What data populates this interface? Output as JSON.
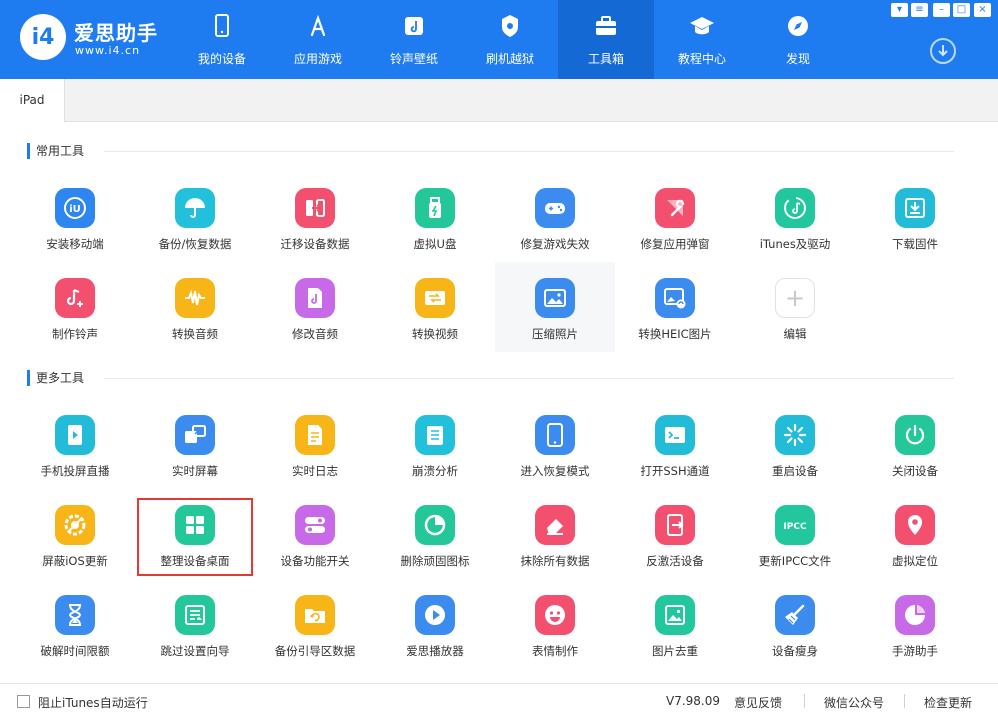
{
  "app": {
    "logo_badge": "i4",
    "name": "爱思助手",
    "url": "www.i4.cn"
  },
  "nav": [
    {
      "label": "我的设备",
      "icon": "phone-icon",
      "active": false
    },
    {
      "label": "应用游戏",
      "icon": "appstore-icon",
      "active": false
    },
    {
      "label": "铃声壁纸",
      "icon": "music-wallpaper-icon",
      "active": false
    },
    {
      "label": "刷机越狱",
      "icon": "flash-icon",
      "active": false
    },
    {
      "label": "工具箱",
      "icon": "toolbox-icon",
      "active": true
    },
    {
      "label": "教程中心",
      "icon": "graduation-cap-icon",
      "active": false
    },
    {
      "label": "发现",
      "icon": "compass-icon",
      "active": false
    }
  ],
  "window_controls": [
    "skin",
    "menu",
    "minimize",
    "close"
  ],
  "tabs": [
    "iPad"
  ],
  "sections": {
    "common": {
      "title": "常用工具"
    },
    "more": {
      "title": "更多工具"
    }
  },
  "common_tools": [
    {
      "label": "安装移动端",
      "icon": "i4-app-icon",
      "color": "#2E86F0"
    },
    {
      "label": "备份/恢复数据",
      "icon": "umbrella-icon",
      "color": "#22C0DA"
    },
    {
      "label": "迁移设备数据",
      "icon": "migrate-icon",
      "color": "#F2506E"
    },
    {
      "label": "虚拟U盘",
      "icon": "usb-drive-icon",
      "color": "#24C79A"
    },
    {
      "label": "修复游戏失效",
      "icon": "gamepad-icon",
      "color": "#3C8CF0"
    },
    {
      "label": "修复应用弹窗",
      "icon": "wrench-icon",
      "color": "#F2506E"
    },
    {
      "label": "iTunes及驱动",
      "icon": "itunes-icon",
      "color": "#22C79E"
    },
    {
      "label": "下载固件",
      "icon": "download-firmware-icon",
      "color": "#22BCD8"
    },
    {
      "label": "制作铃声",
      "icon": "ringtone-icon",
      "color": "#F2506E"
    },
    {
      "label": "转换音频",
      "icon": "waveform-icon",
      "color": "#F7B518"
    },
    {
      "label": "修改音频",
      "icon": "audio-file-icon",
      "color": "#C86AE8"
    },
    {
      "label": "转换视频",
      "icon": "video-convert-icon",
      "color": "#F7B518"
    },
    {
      "label": "压缩照片",
      "icon": "photo-icon",
      "color": "#3C8CF0"
    },
    {
      "label": "转换HEIC图片",
      "icon": "heic-icon",
      "color": "#3C8CF0"
    },
    {
      "label": "编辑",
      "icon": "add-icon",
      "color": "#C8C8C8"
    }
  ],
  "more_tools": [
    {
      "label": "手机投屏直播",
      "icon": "screen-mirror-icon",
      "color": "#22BCD8"
    },
    {
      "label": "实时屏幕",
      "icon": "realtime-screen-icon",
      "color": "#3C8CF0"
    },
    {
      "label": "实时日志",
      "icon": "log-icon",
      "color": "#F7B518"
    },
    {
      "label": "崩溃分析",
      "icon": "crash-analysis-icon",
      "color": "#22C0DA"
    },
    {
      "label": "进入恢复模式",
      "icon": "recovery-mode-icon",
      "color": "#3C8CF0"
    },
    {
      "label": "打开SSH通道",
      "icon": "ssh-icon",
      "color": "#22BCD8"
    },
    {
      "label": "重启设备",
      "icon": "restart-icon",
      "color": "#22BCD8"
    },
    {
      "label": "关闭设备",
      "icon": "power-icon",
      "color": "#24C79A"
    },
    {
      "label": "屏蔽iOS更新",
      "icon": "block-update-icon",
      "color": "#F7B518"
    },
    {
      "label": "整理设备桌面",
      "icon": "grid-icon",
      "color": "#24C79A"
    },
    {
      "label": "设备功能开关",
      "icon": "toggle-icon",
      "color": "#C86AE8"
    },
    {
      "label": "删除顽固图标",
      "icon": "pie-icon",
      "color": "#24C79A"
    },
    {
      "label": "抹除所有数据",
      "icon": "eraser-icon",
      "color": "#F2506E"
    },
    {
      "label": "反激活设备",
      "icon": "deactivate-icon",
      "color": "#F2506E"
    },
    {
      "label": "更新IPCC文件",
      "icon": "ipcc-icon",
      "color": "#22C79E"
    },
    {
      "label": "虚拟定位",
      "icon": "location-pin-icon",
      "color": "#F2506E"
    },
    {
      "label": "破解时间限额",
      "icon": "hourglass-icon",
      "color": "#3C8CF0"
    },
    {
      "label": "跳过设置向导",
      "icon": "skip-setup-icon",
      "color": "#24C79A"
    },
    {
      "label": "备份引导区数据",
      "icon": "folder-backup-icon",
      "color": "#F7B518"
    },
    {
      "label": "爱思播放器",
      "icon": "play-icon",
      "color": "#3C8CF0"
    },
    {
      "label": "表情制作",
      "icon": "emoji-icon",
      "color": "#F2506E"
    },
    {
      "label": "图片去重",
      "icon": "dedupe-photo-icon",
      "color": "#22C79E"
    },
    {
      "label": "设备瘦身",
      "icon": "broom-icon",
      "color": "#3C8CF0"
    },
    {
      "label": "手游助手",
      "icon": "game-assistant-icon",
      "color": "#C86AE8"
    }
  ],
  "footer": {
    "checkbox_label": "阻止iTunes自动运行",
    "checkbox_checked": false,
    "version": "V7.98.09",
    "feedback": "意见反馈",
    "wechat": "微信公众号",
    "check_update": "检查更新"
  }
}
